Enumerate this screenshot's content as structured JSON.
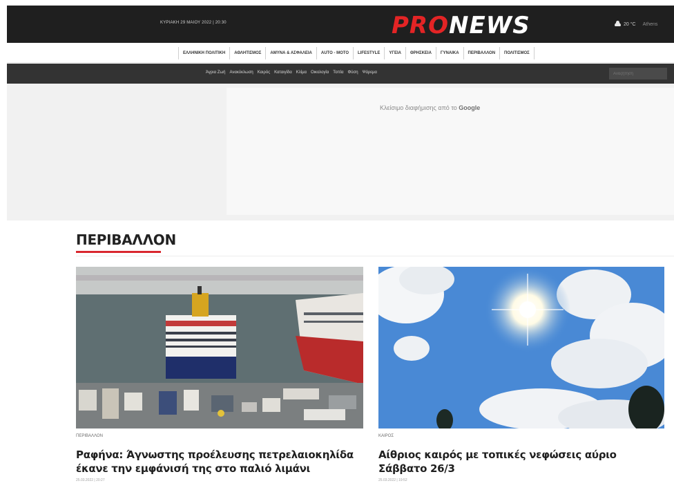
{
  "header": {
    "date": "ΚΥΡΙΑΚΗ 29 ΜΑΙΟΥ 2022 | 20:30",
    "logo_pro": "PRO",
    "logo_news": "NEWS",
    "weather_icon": "cloud-icon",
    "temperature": "20 °C",
    "city": "Athens"
  },
  "category_nav": [
    "ΕΛΛΗΝΙΚΗ ΠΟΛΙΤΙΚΗ",
    "ΑΘΛΗΤΙΣΜΟΣ",
    "ΑΜΥΝΑ & ΑΣΦΑΛΕΙΑ",
    "AUTO - MOTO",
    "LIFESTYLE",
    "ΥΓΕΙΑ",
    "ΘΡΗΣΚΕΙΑ",
    "ΓΥΝΑΙΚΑ",
    "ΠΕΡΙΒΑΛΛΟΝ",
    "ΠΟΛΙΤΙΣΜΟΣ"
  ],
  "sub_nav": [
    "Άγρια Ζωή",
    "Ανακύκλωση",
    "Καιρός",
    "Καταιγίδα",
    "Κλίμα",
    "Οικολογία",
    "Τοπία",
    "Φύση",
    "Ψάρεμα"
  ],
  "search": {
    "placeholder": "Αναζήτηση"
  },
  "ad": {
    "label": "Κλείσιμο διαφήμισης από το",
    "brand": "Google"
  },
  "section": {
    "title": "ΠΕΡΙΒΑΛΛΟΝ"
  },
  "articles": [
    {
      "tag": "ΠΕΡΙΒΑΛΛΟΝ",
      "headline_line1": "Ραφήνα: Άγνωστης προέλευσης πετρελαιοκηλίδα",
      "headline_line2": "έκανε την εμφάνισή της στο παλιό λιμάνι",
      "meta": "25.03.2022 | 20:27"
    },
    {
      "tag": "ΚΑΙΡΟΣ",
      "headline_line1": "Αίθριος καιρός με τοπικές νεφώσεις αύριο",
      "headline_line2": "Σάββατο 26/3",
      "meta": "25.03.2022 | 19:52"
    }
  ],
  "colors": {
    "brand_red": "#e32425",
    "accent_underline": "#d9272e",
    "dark_bar": "#1f1f1f"
  }
}
